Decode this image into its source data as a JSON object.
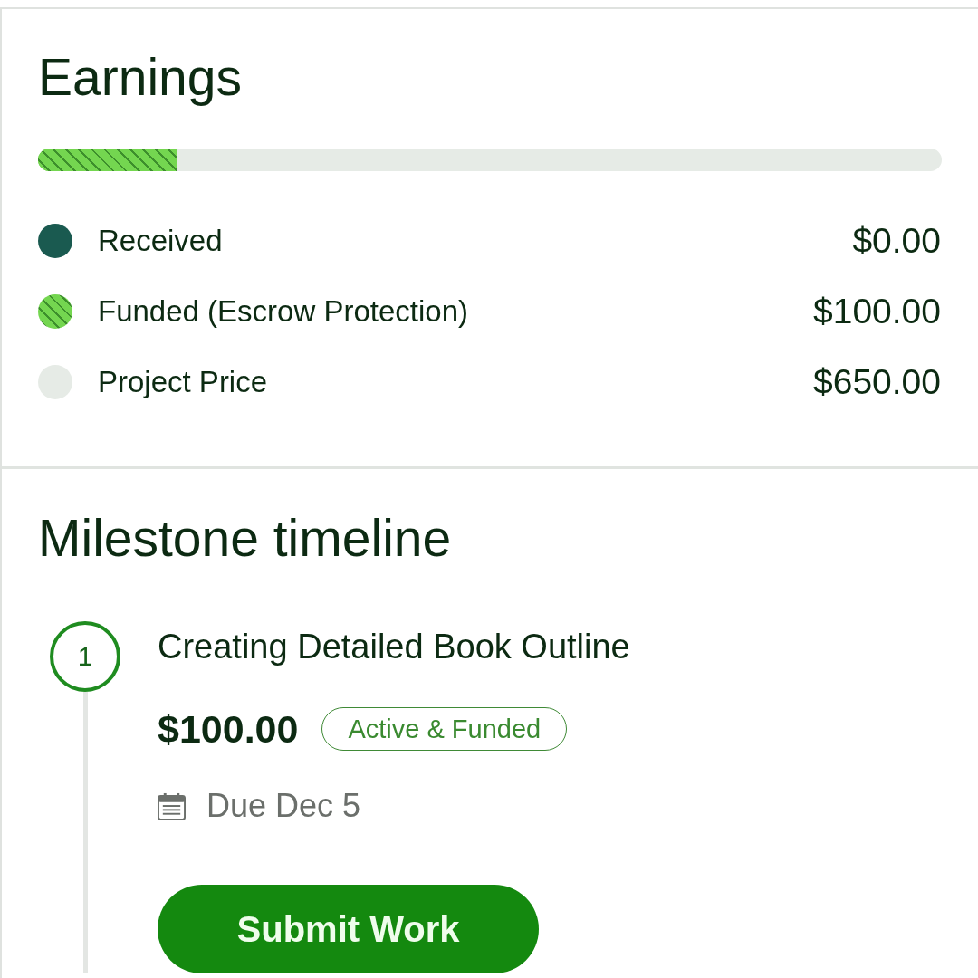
{
  "earnings": {
    "title": "Earnings",
    "progress": {
      "level": 0.154
    },
    "legend": [
      {
        "kind": "solid",
        "label": "Received",
        "amount": "$0.00",
        "color": "#1a5a50"
      },
      {
        "kind": "hatched",
        "label": "Funded (Escrow Protection)",
        "amount": "$100.00",
        "color": "#74d650"
      },
      {
        "kind": "solid",
        "label": "Project Price",
        "amount": "$650.00",
        "color": "#e6ebe6"
      }
    ]
  },
  "milestone_timeline": {
    "title": "Milestone timeline",
    "milestones": [
      {
        "number": "1",
        "title": "Creating Detailed Book Outline",
        "amount": "$100.00",
        "status": "Active & Funded",
        "due": "Due Dec 5",
        "action": "Submit Work"
      }
    ]
  }
}
